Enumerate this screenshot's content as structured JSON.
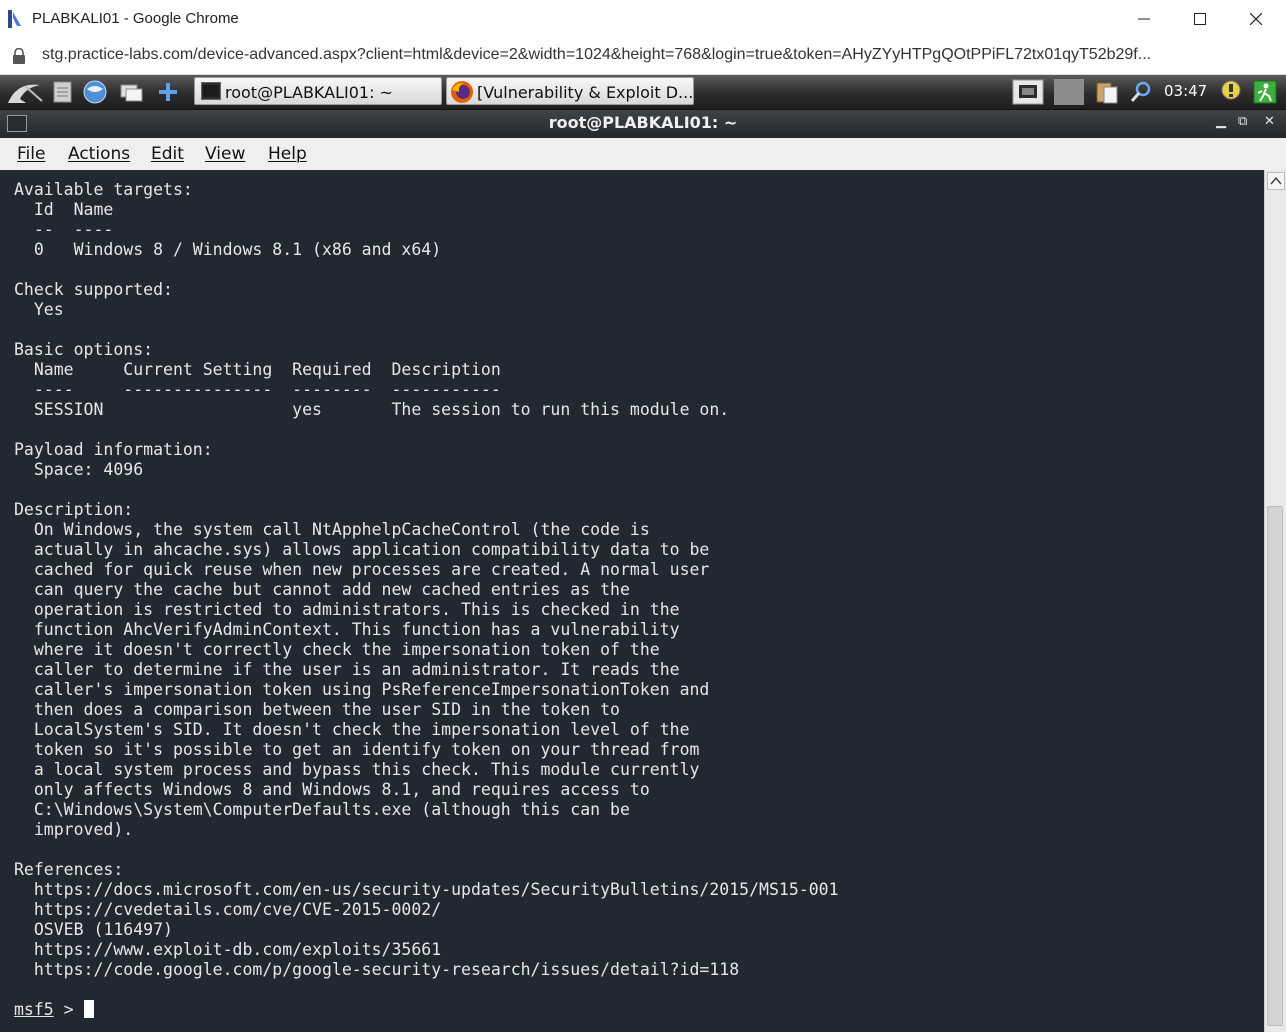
{
  "browser": {
    "window_title": "PLABKALI01 - Google Chrome",
    "url": "stg.practice-labs.com/device-advanced.aspx?client=html&device=2&width=1024&height=768&login=true&token=AHyZYyHTPgQOtPPiFL72tx01qyT52b29f..."
  },
  "taskbar": {
    "tasks": [
      {
        "label": "root@PLABKALI01: ~"
      },
      {
        "label": "[Vulnerability & Exploit D..."
      }
    ],
    "clock": "03:47"
  },
  "terminal": {
    "title": "root@PLABKALI01: ~",
    "menu": [
      "File",
      "Actions",
      "Edit",
      "View",
      "Help"
    ],
    "output": "Available targets:\n  Id  Name\n  --  ----\n  0   Windows 8 / Windows 8.1 (x86 and x64)\n\nCheck supported:\n  Yes\n\nBasic options:\n  Name     Current Setting  Required  Description\n  ----     ---------------  --------  -----------\n  SESSION                   yes       The session to run this module on.\n\nPayload information:\n  Space: 4096\n\nDescription:\n  On Windows, the system call NtApphelpCacheControl (the code is\n  actually in ahcache.sys) allows application compatibility data to be\n  cached for quick reuse when new processes are created. A normal user\n  can query the cache but cannot add new cached entries as the\n  operation is restricted to administrators. This is checked in the\n  function AhcVerifyAdminContext. This function has a vulnerability\n  where it doesn't correctly check the impersonation token of the\n  caller to determine if the user is an administrator. It reads the\n  caller's impersonation token using PsReferenceImpersonationToken and\n  then does a comparison between the user SID in the token to\n  LocalSystem's SID. It doesn't check the impersonation level of the\n  token so it's possible to get an identify token on your thread from\n  a local system process and bypass this check. This module currently\n  only affects Windows 8 and Windows 8.1, and requires access to\n  C:\\Windows\\System\\ComputerDefaults.exe (although this can be\n  improved).\n\nReferences:\n  https://docs.microsoft.com/en-us/security-updates/SecurityBulletins/2015/MS15-001\n  https://cvedetails.com/cve/CVE-2015-0002/\n  OSVEB (116497)\n  https://www.exploit-db.com/exploits/35661\n  https://code.google.com/p/google-security-research/issues/detail?id=118",
    "prompt": "msf5",
    "prompt_symbol": " > "
  },
  "icons": [
    "kali-menu-icon",
    "files-icon",
    "browser-icon",
    "windows-icon",
    "add-icon",
    "terminal-icon",
    "firefox-icon",
    "monitor-icon",
    "clipboard-icon",
    "search-icon",
    "notification-icon",
    "logout-icon"
  ],
  "colors": {
    "terminal_bg": "#222831",
    "terminal_fg": "#e6e6e6",
    "taskbar_bg": "#2c2c2c"
  }
}
